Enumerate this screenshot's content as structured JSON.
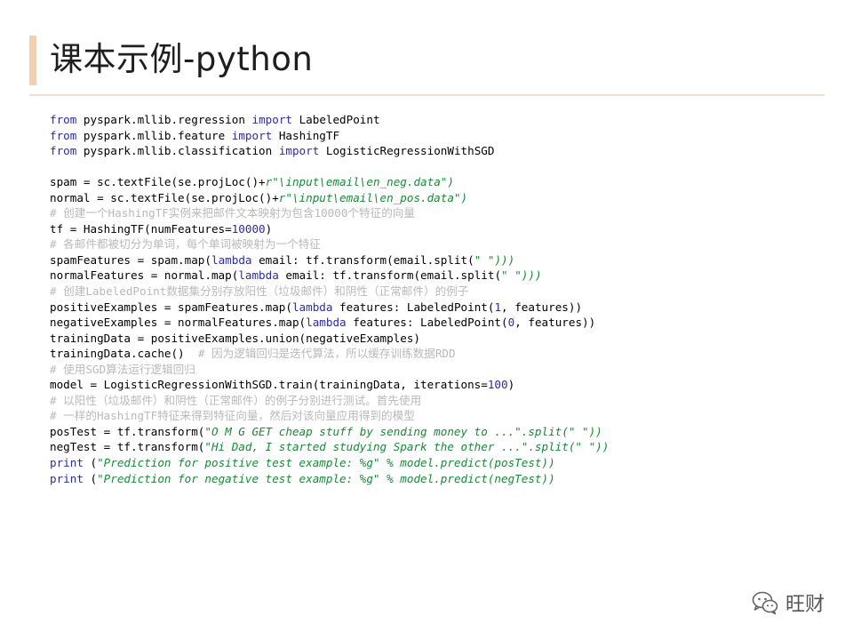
{
  "slide": {
    "title": "课本示例-python"
  },
  "code": {
    "lines": [
      [
        {
          "t": "kw",
          "v": "from"
        },
        {
          "t": "tx",
          "v": " pyspark.mllib.regression "
        },
        {
          "t": "kw",
          "v": "import"
        },
        {
          "t": "tx",
          "v": " LabeledPoint"
        }
      ],
      [
        {
          "t": "kw",
          "v": "from"
        },
        {
          "t": "tx",
          "v": " pyspark.mllib.feature "
        },
        {
          "t": "kw",
          "v": "import"
        },
        {
          "t": "tx",
          "v": " HashingTF"
        }
      ],
      [
        {
          "t": "kw",
          "v": "from"
        },
        {
          "t": "tx",
          "v": " pyspark.mllib.classification "
        },
        {
          "t": "kw",
          "v": "import"
        },
        {
          "t": "tx",
          "v": " LogisticRegressionWithSGD"
        }
      ],
      [],
      [
        {
          "t": "tx",
          "v": "spam = sc.textFile(se.projLoc()+"
        },
        {
          "t": "st",
          "v": "r\"\\input\\email\\en_neg.data\")"
        }
      ],
      [
        {
          "t": "tx",
          "v": "normal = sc.textFile(se.projLoc()+"
        },
        {
          "t": "st",
          "v": "r\"\\input\\email\\en_pos.data\")"
        }
      ],
      [
        {
          "t": "cm",
          "v": "# 创建一个HashingTF实例来把邮件文本映射为包含10000个特征的向量"
        }
      ],
      [
        {
          "t": "tx",
          "v": "tf = HashingTF(numFeatures="
        },
        {
          "t": "nm",
          "v": "10000"
        },
        {
          "t": "tx",
          "v": ")"
        }
      ],
      [
        {
          "t": "cm",
          "v": "# 各邮件都被切分为单词，每个单词被映射为一个特征"
        }
      ],
      [
        {
          "t": "tx",
          "v": "spamFeatures = spam.map("
        },
        {
          "t": "kw",
          "v": "lambda"
        },
        {
          "t": "tx",
          "v": " email: tf.transform(email.split("
        },
        {
          "t": "st",
          "v": "\" \")))"
        }
      ],
      [
        {
          "t": "tx",
          "v": "normalFeatures = normal.map("
        },
        {
          "t": "kw",
          "v": "lambda"
        },
        {
          "t": "tx",
          "v": " email: tf.transform(email.split("
        },
        {
          "t": "st",
          "v": "\" \")))"
        }
      ],
      [
        {
          "t": "cm",
          "v": "# 创建LabeledPoint数据集分别存放阳性（垃圾邮件）和阴性（正常邮件）的例子"
        }
      ],
      [
        {
          "t": "tx",
          "v": "positiveExamples = spamFeatures.map("
        },
        {
          "t": "kw",
          "v": "lambda"
        },
        {
          "t": "tx",
          "v": " features: LabeledPoint("
        },
        {
          "t": "nm",
          "v": "1"
        },
        {
          "t": "tx",
          "v": ", features))"
        }
      ],
      [
        {
          "t": "tx",
          "v": "negativeExamples = normalFeatures.map("
        },
        {
          "t": "kw",
          "v": "lambda"
        },
        {
          "t": "tx",
          "v": " features: LabeledPoint("
        },
        {
          "t": "nm",
          "v": "0"
        },
        {
          "t": "tx",
          "v": ", features))"
        }
      ],
      [
        {
          "t": "tx",
          "v": "trainingData = positiveExamples.union(negativeExamples)"
        }
      ],
      [
        {
          "t": "tx",
          "v": "trainingData.cache()  "
        },
        {
          "t": "cm",
          "v": "# 因为逻辑回归是迭代算法，所以缓存训练数据RDD"
        }
      ],
      [
        {
          "t": "cm",
          "v": "# 使用SGD算法运行逻辑回归"
        }
      ],
      [
        {
          "t": "tx",
          "v": "model = LogisticRegressionWithSGD.train(trainingData, iterations="
        },
        {
          "t": "nm",
          "v": "100"
        },
        {
          "t": "tx",
          "v": ")"
        }
      ],
      [
        {
          "t": "cm",
          "v": "# 以阳性（垃圾邮件）和阴性（正常邮件）的例子分别进行测试。首先使用"
        }
      ],
      [
        {
          "t": "cm",
          "v": "# 一样的HashingTF特征来得到特征向量，然后对该向量应用得到的模型"
        }
      ],
      [
        {
          "t": "tx",
          "v": "posTest = tf.transform("
        },
        {
          "t": "st",
          "v": "\"O M G GET cheap stuff by sending money to ...\".split(\" \"))"
        }
      ],
      [
        {
          "t": "tx",
          "v": "negTest = tf.transform("
        },
        {
          "t": "st",
          "v": "\"Hi Dad, I started studying Spark the other ...\".split(\" \"))"
        }
      ],
      [
        {
          "t": "kw",
          "v": "print"
        },
        {
          "t": "tx",
          "v": " ("
        },
        {
          "t": "st",
          "v": "\"Prediction for positive test example: %g\" % model.predict(posTest))"
        }
      ],
      [
        {
          "t": "kw",
          "v": "print"
        },
        {
          "t": "tx",
          "v": " ("
        },
        {
          "t": "st",
          "v": "\"Prediction for negative test example: %g\" % model.predict(negTest))"
        }
      ]
    ]
  },
  "watermark": {
    "icon": "wechat-icon",
    "label": "旺财"
  },
  "colors": {
    "keyword": "#2c2ca4",
    "string": "#1a8a38",
    "comment": "#b9b9b9",
    "title_bar": "#f1cfb3"
  }
}
